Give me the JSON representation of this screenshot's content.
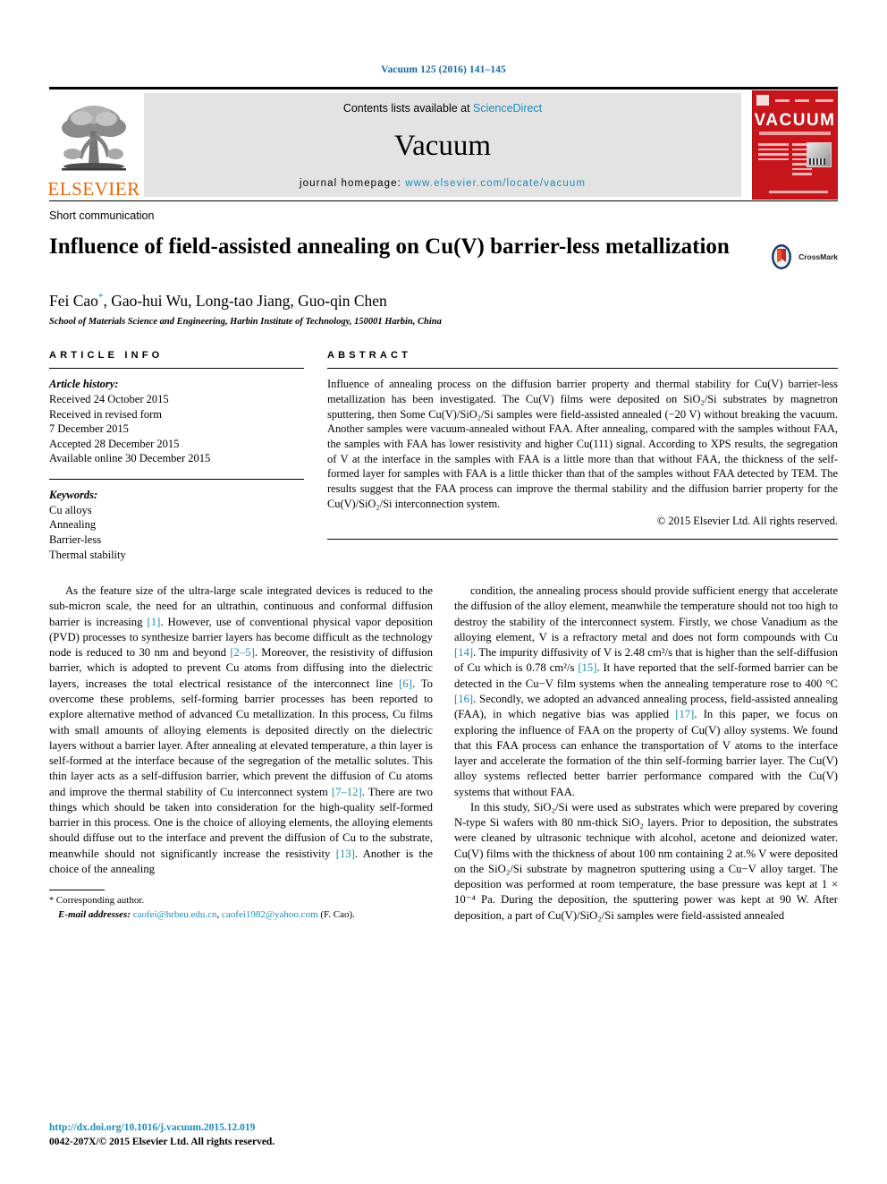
{
  "running_head": "Vacuum 125 (2016) 141–145",
  "masthead": {
    "publisher_name": "ELSEVIER",
    "contents_prefix": "Contents lists available at ",
    "contents_link": "ScienceDirect",
    "journal_name": "Vacuum",
    "homepage_prefix": "journal homepage: ",
    "homepage_url": "www.elsevier.com/locate/vacuum",
    "cover_title": "VACUUM",
    "link_color": "#1b8bbd",
    "elsevier_orange": "#ec6608",
    "cover_red": "#c6161b"
  },
  "article": {
    "type": "Short communication",
    "title": "Influence of field-assisted annealing on Cu(V) barrier-less metallization",
    "crossmark_label": "CrossMark",
    "authors": "Fei Cao",
    "authors_rest": ", Gao-hui Wu, Long-tao Jiang, Guo-qin Chen",
    "corresponding_mark": "*",
    "affiliation": "School of Materials Science and Engineering, Harbin Institute of Technology, 150001 Harbin, China"
  },
  "info": {
    "heading": "ARTICLE INFO",
    "history_label": "Article history:",
    "history": [
      "Received 24 October 2015",
      "Received in revised form",
      "7 December 2015",
      "Accepted 28 December 2015",
      "Available online 30 December 2015"
    ],
    "keywords_label": "Keywords:",
    "keywords": [
      "Cu alloys",
      "Annealing",
      "Barrier-less",
      "Thermal stability"
    ]
  },
  "abstract": {
    "heading": "ABSTRACT",
    "paragraphs": [
      "Influence of annealing process on the diffusion barrier property and thermal stability for Cu(V) barrier-less metallization has been investigated. The Cu(V) films were deposited on SiO₂/Si substrates by magnetron sputtering, then Some Cu(V)/SiO₂/Si samples were field-assisted annealed (−20 V) without breaking the vacuum. Another samples were vacuum-annealed without FAA. After annealing, compared with the samples without FAA, the samples with FAA has lower resistivity and higher Cu(111) signal. According to XPS results, the segregation of V at the interface in the samples with FAA is a little more than that without FAA, the thickness of the self-formed layer for samples with FAA is a little thicker than that of the samples without FAA detected by TEM. The results suggest that the FAA process can improve the thermal stability and the diffusion barrier property for the Cu(V)/SiO₂/Si interconnection system."
    ],
    "copyright": "© 2015 Elsevier Ltd. All rights reserved."
  },
  "body": {
    "left_paragraph": "As the feature size of the ultra-large scale integrated devices is reduced to the sub-micron scale, the need for an ultrathin, continuous and conformal diffusion barrier is increasing [1]. However, use of conventional physical vapor deposition (PVD) processes to synthesize barrier layers has become difficult as the technology node is reduced to 30 nm and beyond [2–5]. Moreover, the resistivity of diffusion barrier, which is adopted to prevent Cu atoms from diffusing into the dielectric layers, increases the total electrical resistance of the interconnect line [6]. To overcome these problems, self-forming barrier processes has been reported to explore alternative method of advanced Cu metallization. In this process, Cu films with small amounts of alloying elements is deposited directly on the dielectric layers without a barrier layer. After annealing at elevated temperature, a thin layer is self-formed at the interface because of the segregation of the metallic solutes. This thin layer acts as a self-diffusion barrier, which prevent the diffusion of Cu atoms and improve the thermal stability of Cu interconnect system [7–12]. There are two things which should be taken into consideration for the high-quality self-formed barrier in this process. One is the choice of alloying elements, the alloying elements should diffuse out to the interface and prevent the diffusion of Cu to the substrate, meanwhile should not significantly increase the resistivity [13]. Another is the choice of the annealing",
    "right_paragraph_1": "condition, the annealing process should provide sufficient energy that accelerate the diffusion of the alloy element, meanwhile the temperature should not too high to destroy the stability of the interconnect system. Firstly, we chose Vanadium as the alloying element, V is a refractory metal and does not form compounds with Cu [14]. The impurity diffusivity of V is 2.48 cm²/s that is higher than the self-diffusion of Cu which is 0.78 cm²/s [15]. It have reported that the self-formed barrier can be detected in the Cu−V film systems when the annealing temperature rose to 400 °C [16]. Secondly, we adopted an advanced annealing process, field-assisted annealing (FAA), in which negative bias was applied [17]. In this paper, we focus on exploring the influence of FAA on the property of Cu(V) alloy systems. We found that this FAA process can enhance the transportation of V atoms to the interface layer and accelerate the formation of the thin self-forming barrier layer. The Cu(V) alloy systems reflected better barrier performance compared with the Cu(V) systems that without FAA.",
    "right_paragraph_2": "In this study, SiO₂/Si were used as substrates which were prepared by covering N-type Si wafers with 80 nm-thick SiO₂ layers. Prior to deposition, the substrates were cleaned by ultrasonic technique with alcohol, acetone and deionized water. Cu(V) films with the thickness of about 100 nm containing 2 at.% V were deposited on the SiO₂/Si substrate by magnetron sputtering using a Cu−V alloy target. The deposition was performed at room temperature, the base pressure was kept at 1 × 10⁻⁴ Pa. During the deposition, the sputtering power was kept at 90 W. After deposition, a part of Cu(V)/SiO₂/Si samples were field-assisted annealed"
  },
  "footnote": {
    "corresponding": "Corresponding author.",
    "email_label": "E-mail addresses:",
    "email_1": "caofei@hrbeu.edu.cn",
    "email_sep": ", ",
    "email_2": "caofei1982@yahoo.com",
    "email_suffix": " (F. Cao)."
  },
  "footer": {
    "doi": "http://dx.doi.org/10.1016/j.vacuum.2015.12.019",
    "issn_line": "0042-207X/© 2015 Elsevier Ltd. All rights reserved."
  }
}
